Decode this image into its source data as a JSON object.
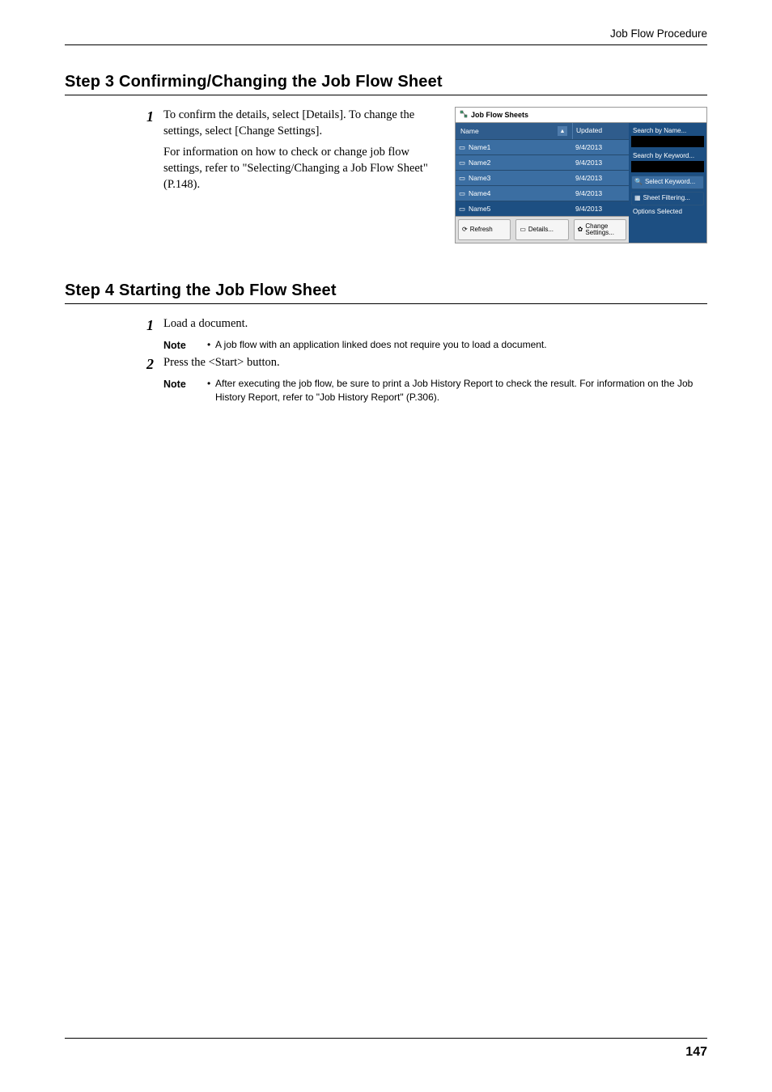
{
  "header": {
    "running": "Job Flow Procedure"
  },
  "step3": {
    "heading": "Step 3 Confirming/Changing the Job Flow Sheet",
    "num": "1",
    "p1": "To confirm the details, select [Details]. To change the settings, select [Change Settings].",
    "p2": "For information on how to check or change job flow settings, refer to \"Selecting/Changing a Job Flow Sheet\" (P.148)."
  },
  "step4": {
    "heading": "Step 4 Starting the Job Flow Sheet",
    "item1_num": "1",
    "item1_text": "Load a document.",
    "item1_note_label": "Note",
    "item1_note": "A job flow with an application linked does not require you to load a document.",
    "item2_num": "2",
    "item2_text": "Press the <Start> button.",
    "item2_note_label": "Note",
    "item2_note": "After executing the job flow, be sure to print a Job History Report to check the result. For information on the Job History Report, refer to \"Job History Report\" (P.306)."
  },
  "ui": {
    "title": "Job Flow Sheets",
    "col_name": "Name",
    "col_updated": "Updated",
    "rows": [
      {
        "name": "Name1",
        "date": "9/4/2013"
      },
      {
        "name": "Name2",
        "date": "9/4/2013"
      },
      {
        "name": "Name3",
        "date": "9/4/2013"
      },
      {
        "name": "Name4",
        "date": "9/4/2013"
      },
      {
        "name": "Name5",
        "date": "9/4/2013"
      }
    ],
    "refresh": "Refresh",
    "details": "Details...",
    "change": "Change Settings...",
    "search_name": "Search by Name...",
    "search_kw": "Search by Keyword...",
    "select_kw": "Select Keyword...",
    "filter": "Sheet Filtering...",
    "options_sel": "Options Selected"
  },
  "page_number": "147"
}
